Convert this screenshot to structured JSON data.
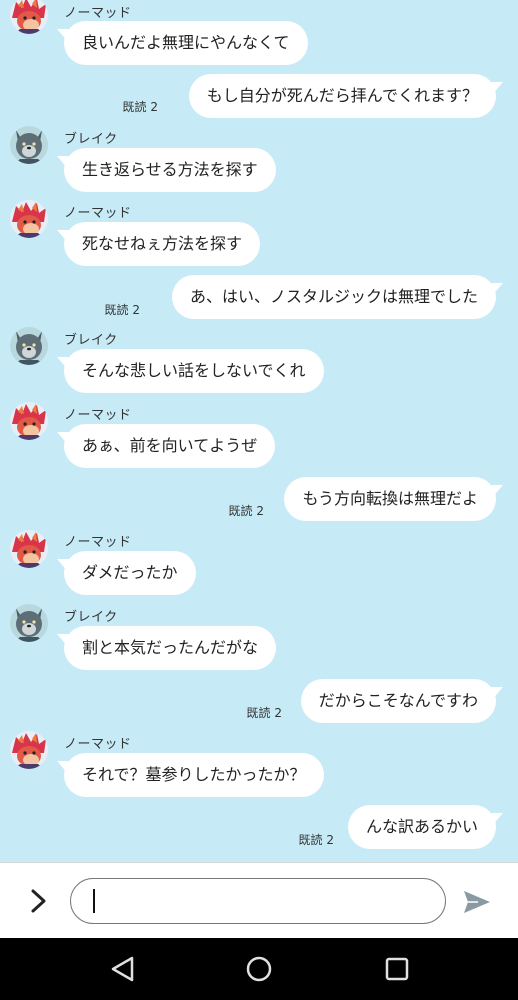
{
  "messages": [
    {
      "side": "in",
      "sender": "ノーマッド",
      "avatar": "nomad",
      "text": "良いんだよ無理にやんなくて"
    },
    {
      "side": "out",
      "read": "既読 2",
      "text": "もし自分が死んだら拝んでくれます？"
    },
    {
      "side": "in",
      "sender": "ブレイク",
      "avatar": "blake",
      "text": "生き返らせる方法を探す"
    },
    {
      "side": "in",
      "sender": "ノーマッド",
      "avatar": "nomad",
      "text": "死なせねぇ方法を探す"
    },
    {
      "side": "out",
      "read": "既読 2",
      "text": "あ、はい、ノスタルジックは無理でした"
    },
    {
      "side": "in",
      "sender": "ブレイク",
      "avatar": "blake",
      "text": "そんな悲しい話をしないでくれ"
    },
    {
      "side": "in",
      "sender": "ノーマッド",
      "avatar": "nomad",
      "text": "あぁ、前を向いてようぜ"
    },
    {
      "side": "out",
      "read": "既読 2",
      "text": "もう方向転換は無理だよ"
    },
    {
      "side": "in",
      "sender": "ノーマッド",
      "avatar": "nomad",
      "text": "ダメだったか"
    },
    {
      "side": "in",
      "sender": "ブレイク",
      "avatar": "blake",
      "text": "割と本気だったんだがな"
    },
    {
      "side": "out",
      "read": "既読 2",
      "text": "だからこそなんですわ"
    },
    {
      "side": "in",
      "sender": "ノーマッド",
      "avatar": "nomad",
      "text": "それで？墓参りしたかったか？"
    },
    {
      "side": "out",
      "read": "既読 2",
      "text": "んな訳あるかい"
    }
  ],
  "input_bar": {
    "expand_icon": "chevron-right-icon",
    "message_value": "",
    "send_icon": "send-icon"
  },
  "nav_bar": {
    "icons": [
      "back-triangle-icon",
      "home-circle-icon",
      "recents-square-icon"
    ]
  },
  "colors": {
    "chat_background": "#c7eaf7",
    "bubble": "#ffffff",
    "nav_background": "#000000",
    "send_icon": "#8a9aa3"
  }
}
